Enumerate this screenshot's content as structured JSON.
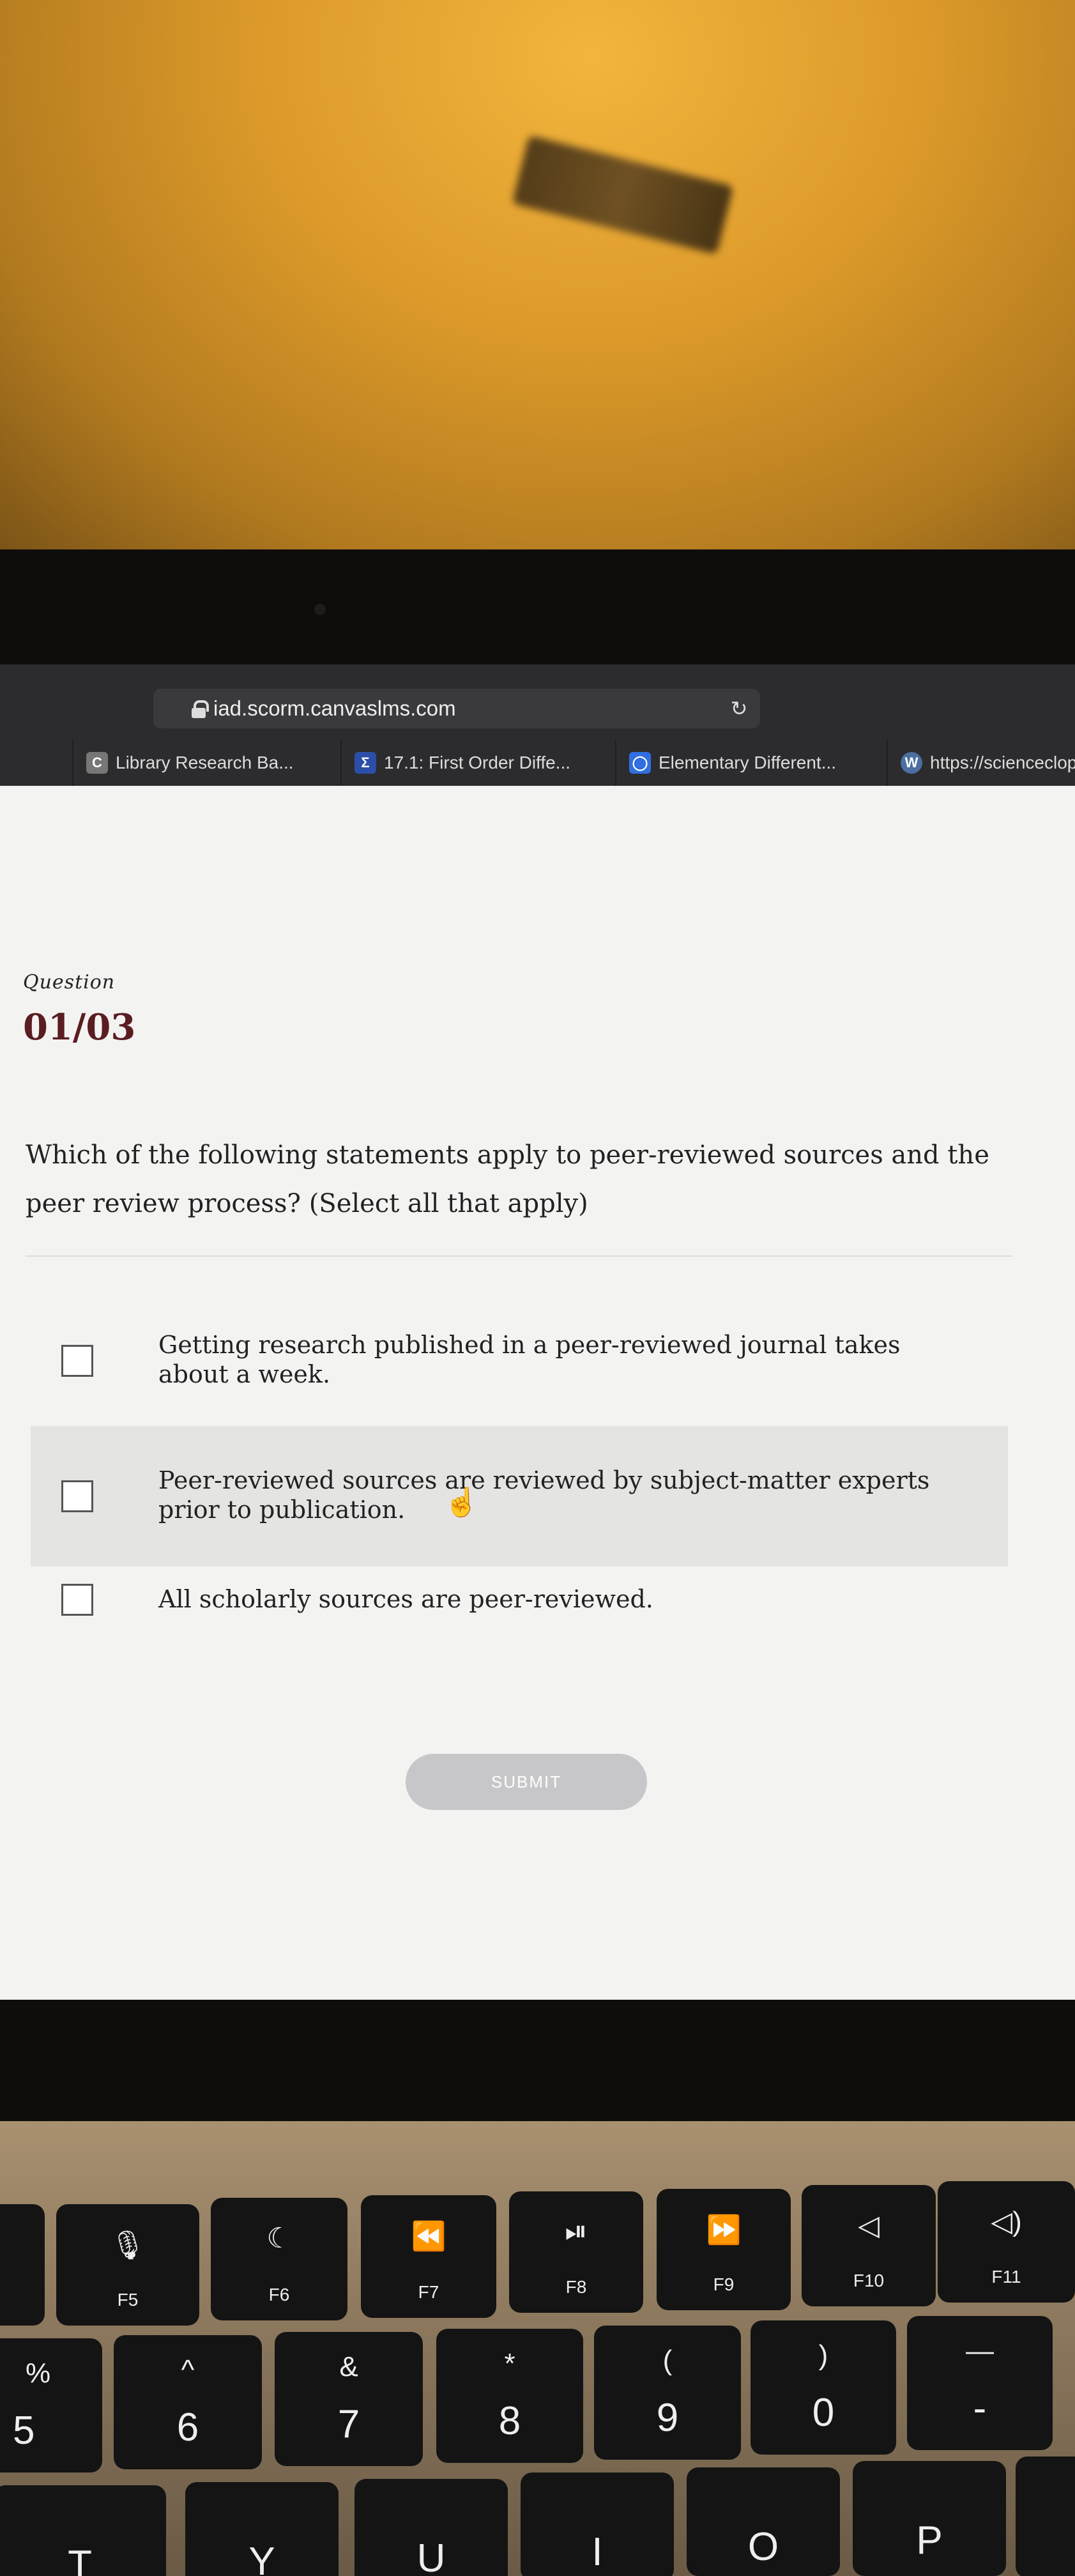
{
  "browser": {
    "url": "iad.scorm.canvaslms.com",
    "tabs": [
      {
        "label": "Library Research Ba...",
        "icon": "canvas-c-icon",
        "icon_char": "C",
        "color": "#777777"
      },
      {
        "label": "17.1: First Order Diffe...",
        "icon": "sigma-icon",
        "icon_char": "Σ",
        "color": "#2b4fa8"
      },
      {
        "label": "Elementary Different...",
        "icon": "circle-app-icon",
        "icon_char": "◯",
        "color": "#2f6fe0"
      },
      {
        "label": "https://scienceclope",
        "icon": "wordpress-icon",
        "icon_char": "W",
        "color": "#4a6fa0"
      }
    ]
  },
  "question": {
    "label": "Question",
    "number": "01/03",
    "text": "Which of the following statements apply to peer-reviewed sources and the peer review process? (Select all that apply)",
    "options": [
      {
        "text": "Getting research published in a peer-reviewed journal takes about a week."
      },
      {
        "text": "Peer-reviewed sources are reviewed by subject-matter experts prior to publication."
      },
      {
        "text": "All scholarly sources are peer-reviewed."
      }
    ],
    "submit_label": "SUBMIT"
  },
  "keyboard": {
    "function_keys": [
      {
        "label": "F5",
        "icon": "microphone-icon",
        "glyph": "🎙"
      },
      {
        "label": "F6",
        "icon": "moon-icon",
        "glyph": "☾"
      },
      {
        "label": "F7",
        "icon": "rewind-icon",
        "glyph": "⏪"
      },
      {
        "label": "F8",
        "icon": "play-pause-icon",
        "glyph": "⏯"
      },
      {
        "label": "F9",
        "icon": "fast-forward-icon",
        "glyph": "⏩"
      },
      {
        "label": "F10",
        "icon": "mute-icon",
        "glyph": "◁"
      },
      {
        "label": "F11",
        "icon": "volume-down-icon",
        "glyph": "◁)"
      }
    ],
    "number_keys": [
      {
        "sym": "%",
        "num": "5"
      },
      {
        "sym": "^",
        "num": "6"
      },
      {
        "sym": "&",
        "num": "7"
      },
      {
        "sym": "*",
        "num": "8"
      },
      {
        "sym": "(",
        "num": "9"
      },
      {
        "sym": ")",
        "num": "0"
      },
      {
        "sym": "—",
        "num": "-"
      }
    ],
    "letter_keys": [
      "T",
      "Y",
      "U",
      "I",
      "O",
      "P"
    ]
  }
}
